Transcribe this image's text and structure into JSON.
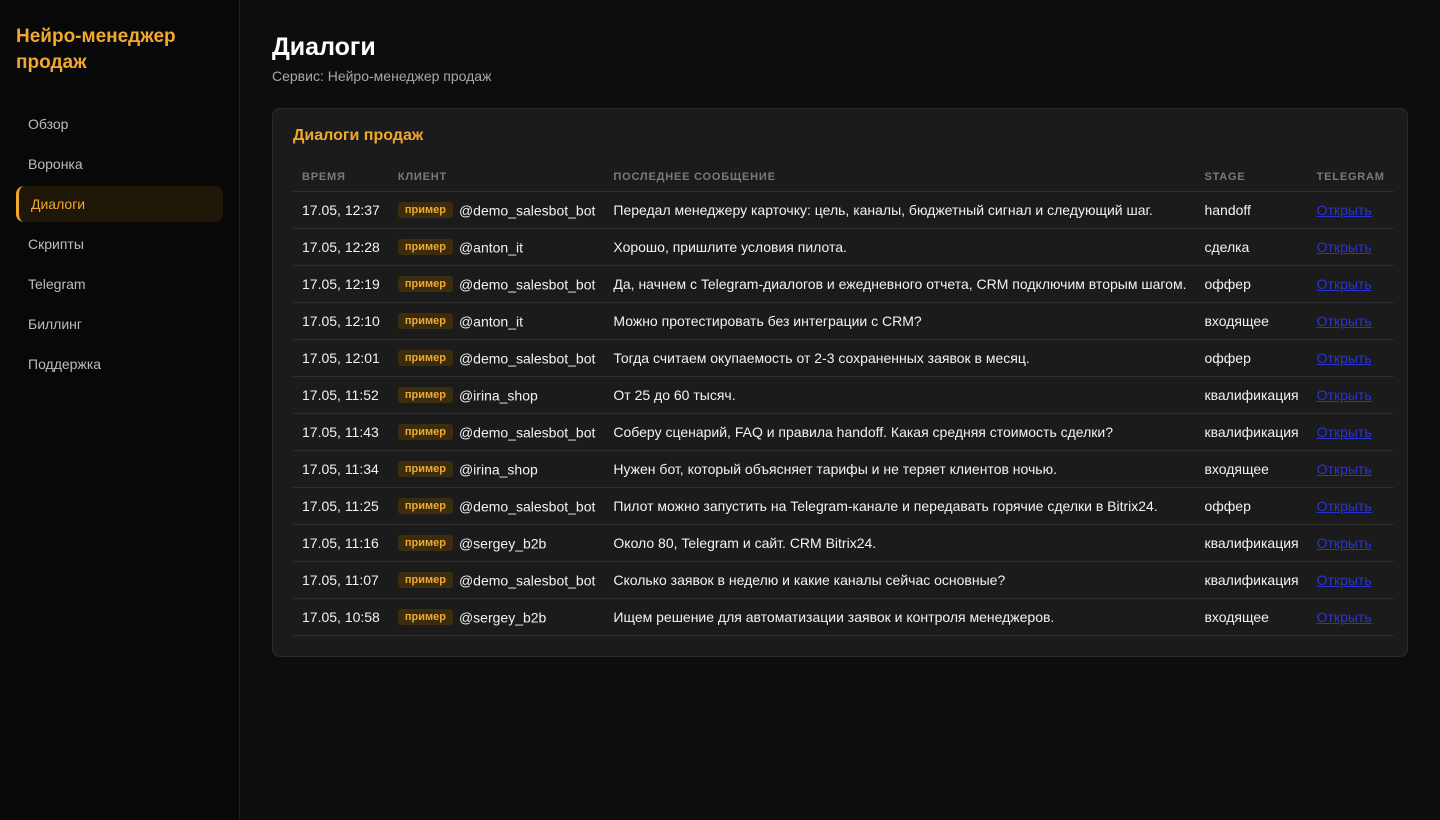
{
  "brand": "Нейро-менеджер продаж",
  "sidebar": {
    "items": [
      {
        "label": "Обзор"
      },
      {
        "label": "Воронка"
      },
      {
        "label": "Диалоги"
      },
      {
        "label": "Скрипты"
      },
      {
        "label": "Telegram"
      },
      {
        "label": "Биллинг"
      },
      {
        "label": "Поддержка"
      }
    ],
    "active_index": 2
  },
  "page": {
    "title": "Диалоги",
    "subtitle": "Сервис: Нейро-менеджер продаж"
  },
  "card": {
    "title": "Диалоги продаж",
    "columns": [
      "Время",
      "Клиент",
      "Последнее сообщение",
      "Stage",
      "Telegram"
    ],
    "rows": [
      {
        "time": "17.05, 12:37",
        "badge": "пример",
        "client": "@demo_salesbot_bot",
        "message": "Передал менеджеру карточку: цель, каналы, бюджетный сигнал и следующий шаг.",
        "stage": "handoff",
        "link": "Открыть"
      },
      {
        "time": "17.05, 12:28",
        "badge": "пример",
        "client": "@anton_it",
        "message": "Хорошо, пришлите условия пилота.",
        "stage": "сделка",
        "link": "Открыть"
      },
      {
        "time": "17.05, 12:19",
        "badge": "пример",
        "client": "@demo_salesbot_bot",
        "message": "Да, начнем с Telegram-диалогов и ежедневного отчета, CRM подключим вторым шагом.",
        "stage": "оффер",
        "link": "Открыть"
      },
      {
        "time": "17.05, 12:10",
        "badge": "пример",
        "client": "@anton_it",
        "message": "Можно протестировать без интеграции с CRM?",
        "stage": "входящее",
        "link": "Открыть"
      },
      {
        "time": "17.05, 12:01",
        "badge": "пример",
        "client": "@demo_salesbot_bot",
        "message": "Тогда считаем окупаемость от 2-3 сохраненных заявок в месяц.",
        "stage": "оффер",
        "link": "Открыть"
      },
      {
        "time": "17.05, 11:52",
        "badge": "пример",
        "client": "@irina_shop",
        "message": "От 25 до 60 тысяч.",
        "stage": "квалификация",
        "link": "Открыть"
      },
      {
        "time": "17.05, 11:43",
        "badge": "пример",
        "client": "@demo_salesbot_bot",
        "message": "Соберу сценарий, FAQ и правила handoff. Какая средняя стоимость сделки?",
        "stage": "квалификация",
        "link": "Открыть"
      },
      {
        "time": "17.05, 11:34",
        "badge": "пример",
        "client": "@irina_shop",
        "message": "Нужен бот, который объясняет тарифы и не теряет клиентов ночью.",
        "stage": "входящее",
        "link": "Открыть"
      },
      {
        "time": "17.05, 11:25",
        "badge": "пример",
        "client": "@demo_salesbot_bot",
        "message": "Пилот можно запустить на Telegram-канале и передавать горячие сделки в Bitrix24.",
        "stage": "оффер",
        "link": "Открыть"
      },
      {
        "time": "17.05, 11:16",
        "badge": "пример",
        "client": "@sergey_b2b",
        "message": "Около 80, Telegram и сайт. CRM Bitrix24.",
        "stage": "квалификация",
        "link": "Открыть"
      },
      {
        "time": "17.05, 11:07",
        "badge": "пример",
        "client": "@demo_salesbot_bot",
        "message": "Сколько заявок в неделю и какие каналы сейчас основные?",
        "stage": "квалификация",
        "link": "Открыть"
      },
      {
        "time": "17.05, 10:58",
        "badge": "пример",
        "client": "@sergey_b2b",
        "message": "Ищем решение для автоматизации заявок и контроля менеджеров.",
        "stage": "входящее",
        "link": "Открыть"
      }
    ]
  },
  "colors": {
    "accent": "#f0a92e",
    "background": "#0d0d0d",
    "card": "#1b1b1b",
    "link": "#2a34d6"
  }
}
